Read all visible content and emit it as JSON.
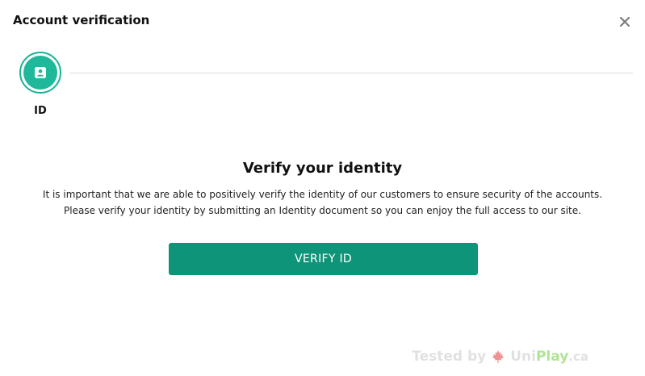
{
  "dialog": {
    "title": "Account verification",
    "close_icon": "close-icon"
  },
  "stepper": {
    "steps": [
      {
        "label": "ID",
        "icon": "id-card-icon",
        "active": true
      }
    ]
  },
  "main": {
    "heading": "Verify your identity",
    "description_line1": "It is important that we are able to positively verify the identity of our customers to ensure security of the accounts.",
    "description_line2": "Please verify your identity by submitting an Identity document so you can enjoy the full access to our site.",
    "verify_button_label": "VERIFY ID"
  },
  "watermark": {
    "tested_by": "Tested by",
    "brand_uni": "Uni",
    "brand_play": "Play",
    "brand_tld": ".ca"
  },
  "colors": {
    "accent": "#1fb89a",
    "button": "#0e9478",
    "divider": "#dddddd"
  }
}
